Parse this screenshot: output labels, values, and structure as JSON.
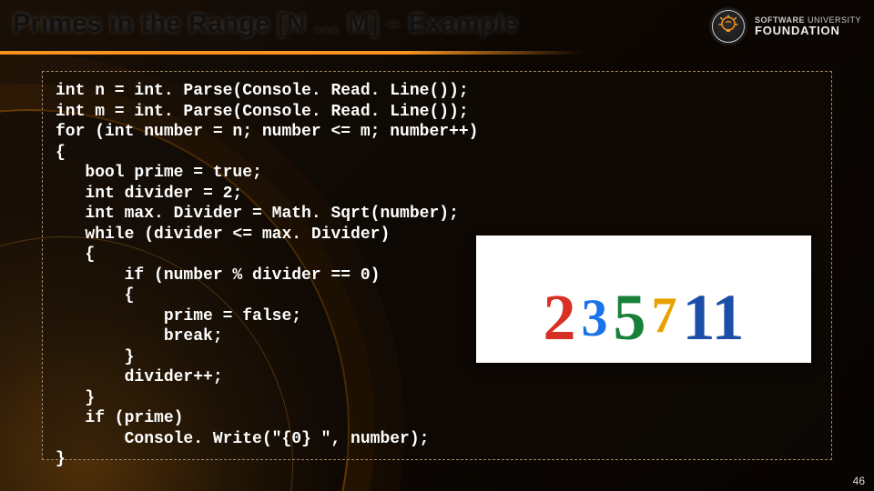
{
  "title": "Primes in the Range [N … M] – Example",
  "logo": {
    "line1_a": "SOFTWARE",
    "line1_b": "UNIVERSITY",
    "line2": "FOUNDATION"
  },
  "code": "int n = int. Parse(Console. Read. Line());\nint m = int. Parse(Console. Read. Line());\nfor (int number = n; number <= m; number++)\n{\n   bool prime = true;\n   int divider = 2;\n   int max. Divider = Math. Sqrt(number);\n   while (divider <= max. Divider)\n   {\n       if (number % divider == 0)\n       {\n           prime = false;\n           break;\n       }\n       divider++;\n   }\n   if (prime)\n       Console. Write(\"{0} \", number);\n}",
  "primes": {
    "p2": {
      "text": "2",
      "color": "#d93025",
      "size": "72px",
      "baseline": "0px"
    },
    "p3": {
      "text": "3",
      "color": "#1a73e8",
      "size": "58px",
      "baseline": "-6px"
    },
    "p5": {
      "text": "5",
      "color": "#188038",
      "size": "72px",
      "baseline": "0px"
    },
    "p7": {
      "text": "7",
      "color": "#e8a200",
      "size": "56px",
      "baseline": "-10px"
    },
    "p11": {
      "text": "11",
      "color": "#1a4ea8",
      "size": "72px",
      "baseline": "0px"
    }
  },
  "page_number": "46"
}
